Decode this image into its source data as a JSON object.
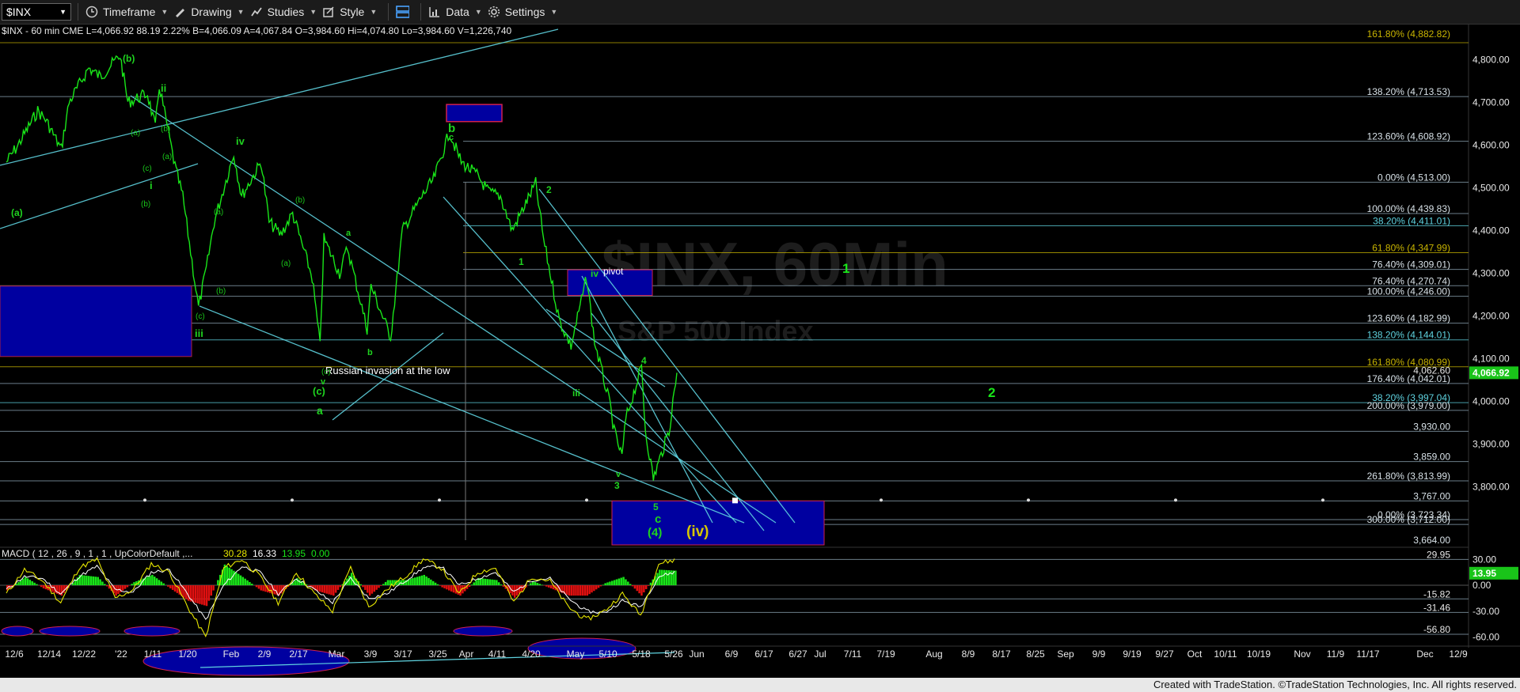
{
  "toolbar": {
    "symbol": "$INX",
    "items": [
      {
        "label": "Timeframe",
        "icon": "timeframe-icon"
      },
      {
        "label": "Drawing",
        "icon": "pencil-icon"
      },
      {
        "label": "Studies",
        "icon": "studies-icon"
      },
      {
        "label": "Style",
        "icon": "style-icon"
      },
      {
        "label": "",
        "icon": "layout-icon"
      },
      {
        "label": "Data",
        "icon": "data-icon"
      },
      {
        "label": "Settings",
        "icon": "gear-icon"
      }
    ]
  },
  "header_text": "$INX - 60 min  CME  L=4,066.92  88.19  2.22%  B=4,066.09  A=4,067.84  O=3,984.60  Hi=4,074.80  Lo=3,984.60  V=1,226,740",
  "watermark": {
    "title": "$INX, 60Min",
    "subtitle": "S&P 500 Index"
  },
  "footer": "Created with TradeStation. ©TradeStation Technologies, Inc. All rights reserved.",
  "colors": {
    "price": "#19e619",
    "trend": "#5fd3e0",
    "box": "#0000a0",
    "level": "#8fa9b8",
    "gold": "#c8b400"
  },
  "chart_data": [
    {
      "type": "line",
      "title": "$INX - 60 min",
      "y_axis": {
        "ylim": [
          3664,
          4860
        ],
        "ticks": [
          "4,800.00",
          "4,700.00",
          "4,600.00",
          "4,500.00",
          "4,400.00",
          "4,300.00",
          "4,200.00",
          "4,100.00",
          "4,000.00",
          "3,900.00",
          "3,800.00"
        ],
        "tick_values": [
          4800,
          4700,
          4600,
          4500,
          4400,
          4300,
          4200,
          4100,
          4000,
          3900,
          3800
        ]
      },
      "x_axis": {
        "labels": [
          "12/6",
          "12/14",
          "12/22",
          "'22",
          "1/11",
          "1/20",
          "Feb",
          "2/9",
          "2/17",
          "Mar",
          "3/9",
          "3/17",
          "3/25",
          "Apr",
          "4/11",
          "4/20",
          "May",
          "5/10",
          "5/18",
          "5/26",
          "Jun",
          "6/9",
          "6/17",
          "6/27",
          "Jul",
          "7/11",
          "7/19",
          "Aug",
          "8/9",
          "8/17",
          "8/25",
          "Sep",
          "9/9",
          "9/19",
          "9/27",
          "Oct",
          "10/11",
          "10/19",
          "Nov",
          "11/9",
          "11/17",
          "Dec",
          "12/9"
        ]
      },
      "series": [
        {
          "name": "$INX",
          "points": [
            [
              "12/6",
              4560
            ],
            [
              "12/9",
              4600
            ],
            [
              "12/14",
              4680
            ],
            [
              "12/16",
              4660
            ],
            [
              "12/20",
              4590
            ],
            [
              "12/22",
              4700
            ],
            [
              "12/27",
              4780
            ],
            [
              "12/30",
              4760
            ],
            [
              "1/4",
              4810
            ],
            [
              "1/6",
              4700
            ],
            [
              "1/11",
              4720
            ],
            [
              "1/13",
              4640
            ],
            [
              "1/14",
              4740
            ],
            [
              "1/18",
              4550
            ],
            [
              "1/20",
              4480
            ],
            [
              "1/24",
              4220
            ],
            [
              "1/26",
              4310
            ],
            [
              "1/28",
              4420
            ],
            [
              "2/2",
              4580
            ],
            [
              "2/4",
              4480
            ],
            [
              "2/9",
              4560
            ],
            [
              "2/11",
              4420
            ],
            [
              "2/14",
              4390
            ],
            [
              "2/17",
              4440
            ],
            [
              "2/22",
              4290
            ],
            [
              "2/24",
              4130
            ],
            [
              "2/25",
              4380
            ],
            [
              "3/1",
              4300
            ],
            [
              "3/3",
              4360
            ],
            [
              "3/8",
              4170
            ],
            [
              "3/9",
              4270
            ],
            [
              "3/14",
              4150
            ],
            [
              "3/17",
              4400
            ],
            [
              "3/22",
              4480
            ],
            [
              "3/25",
              4520
            ],
            [
              "3/29",
              4630
            ],
            [
              "4/1",
              4560
            ],
            [
              "4/5",
              4530
            ],
            [
              "4/8",
              4490
            ],
            [
              "4/11",
              4480
            ],
            [
              "4/14",
              4400
            ],
            [
              "4/20",
              4510
            ],
            [
              "4/22",
              4380
            ],
            [
              "4/26",
              4190
            ],
            [
              "4/29",
              4130
            ],
            [
              "5/3",
              4290
            ],
            [
              "5/5",
              4140
            ],
            [
              "5/9",
              3990
            ],
            [
              "5/10",
              3930
            ],
            [
              "5/12",
              3870
            ],
            [
              "5/13",
              3960
            ],
            [
              "5/17",
              4080
            ],
            [
              "5/18",
              3930
            ],
            [
              "5/20",
              3820
            ],
            [
              "5/24",
              3930
            ],
            [
              "5/26",
              4067
            ]
          ]
        }
      ],
      "horizontal_levels": [
        {
          "label": "138.20% (4,713.53)",
          "value": 4713.53
        },
        {
          "label": "123.60% (4,608.92)",
          "value": 4608.92
        },
        {
          "label": "0.00% (4,513.00)",
          "value": 4513
        },
        {
          "label": "100.00% (4,439.83)",
          "value": 4439.83
        },
        {
          "label": "38.20% (4,411.01)",
          "value": 4411.01
        },
        {
          "label": "61.80% (4,347.99)",
          "value": 4347.99
        },
        {
          "label": "76.40% (4,309.01)",
          "value": 4309.01
        },
        {
          "label": "76.40% (4,270.74)",
          "value": 4270.74
        },
        {
          "label": "100.00% (4,246.00)",
          "value": 4246
        },
        {
          "label": "123.60% (4,182.99)",
          "value": 4182.99
        },
        {
          "label": "138.20% (4,144.01)",
          "value": 4144.01
        },
        {
          "label": "161.80% (4,080.99)",
          "value": 4080.99
        },
        {
          "label": "176.40% (4,042.01)",
          "value": 4042.01
        },
        {
          "label": "38.20% (3,997.04)",
          "value": 3997.04
        },
        {
          "label": "200.00% (3,979.00)",
          "value": 3979
        },
        {
          "label": "3,930.00",
          "value": 3930
        },
        {
          "label": "3,859.00",
          "value": 3859
        },
        {
          "label": "261.80% (3,813.99)",
          "value": 3813.99
        },
        {
          "label": "3,767.00",
          "value": 3767
        },
        {
          "label": "0.00% (3,723.34)",
          "value": 3723.34
        },
        {
          "label": "300.00% (3,712.00)",
          "value": 3712
        }
      ],
      "top_level_label": "161.80% (4,882.82)",
      "bottom_level_label": "3,664.00",
      "last_price_label": "4,066.92",
      "prev_price_label": "4,062.60",
      "annotations": [
        "(b)",
        "ii",
        "iv",
        "i",
        "(a)",
        "iii",
        "(c)",
        "a",
        "b",
        "c",
        "v",
        "Russian invasion at the low",
        "1",
        "2",
        "3",
        "4",
        "5",
        "iv",
        "iii",
        "v",
        "(4)",
        "(iv)",
        "pivot"
      ],
      "wave_labels_big": [
        "1",
        "2"
      ]
    },
    {
      "type": "bar",
      "title": "MACD ( 12 , 26 , 9 , 1 , 1 , UpColorDefault ,... 30.28 16.33 13.95 0.00",
      "legend": [
        "MACD ( 12 , 26 , 9 , 1 , 1 , UpColorDefault ,...",
        "30.28",
        "16.33",
        "13.95",
        "0.00"
      ],
      "y_axis": {
        "ylim": [
          -65,
          33
        ],
        "ticks": [
          "30.00",
          "0.00",
          "-30.00",
          "-60.00"
        ],
        "tick_values": [
          30,
          0,
          -30,
          -60
        ]
      },
      "levels": [
        {
          "label": "29.95",
          "value": 29.95
        },
        {
          "label": "-15.82",
          "value": -15.82
        },
        {
          "label": "-31.46",
          "value": -31.46
        },
        {
          "label": "-56.80",
          "value": -56.8
        }
      ],
      "current_label": "13.95",
      "series": [
        {
          "name": "MACD",
          "values": [
            -10,
            18,
            5,
            -20,
            20,
            30,
            -15,
            -5,
            25,
            15,
            -25,
            -60,
            20,
            30,
            10,
            -20,
            15,
            -10,
            -30,
            20,
            -25,
            -5,
            10,
            30,
            20,
            -10,
            15,
            20,
            -20,
            10,
            5,
            -25,
            -40,
            -30,
            -10,
            -35,
            25,
            30
          ]
        },
        {
          "name": "Signal",
          "values": [
            -5,
            10,
            8,
            -10,
            10,
            22,
            -5,
            -8,
            15,
            18,
            -10,
            -40,
            0,
            22,
            15,
            -10,
            8,
            -5,
            -20,
            8,
            -15,
            -10,
            5,
            20,
            22,
            0,
            8,
            15,
            -8,
            6,
            8,
            -15,
            -30,
            -32,
            -18,
            -25,
            10,
            16
          ]
        }
      ]
    }
  ]
}
